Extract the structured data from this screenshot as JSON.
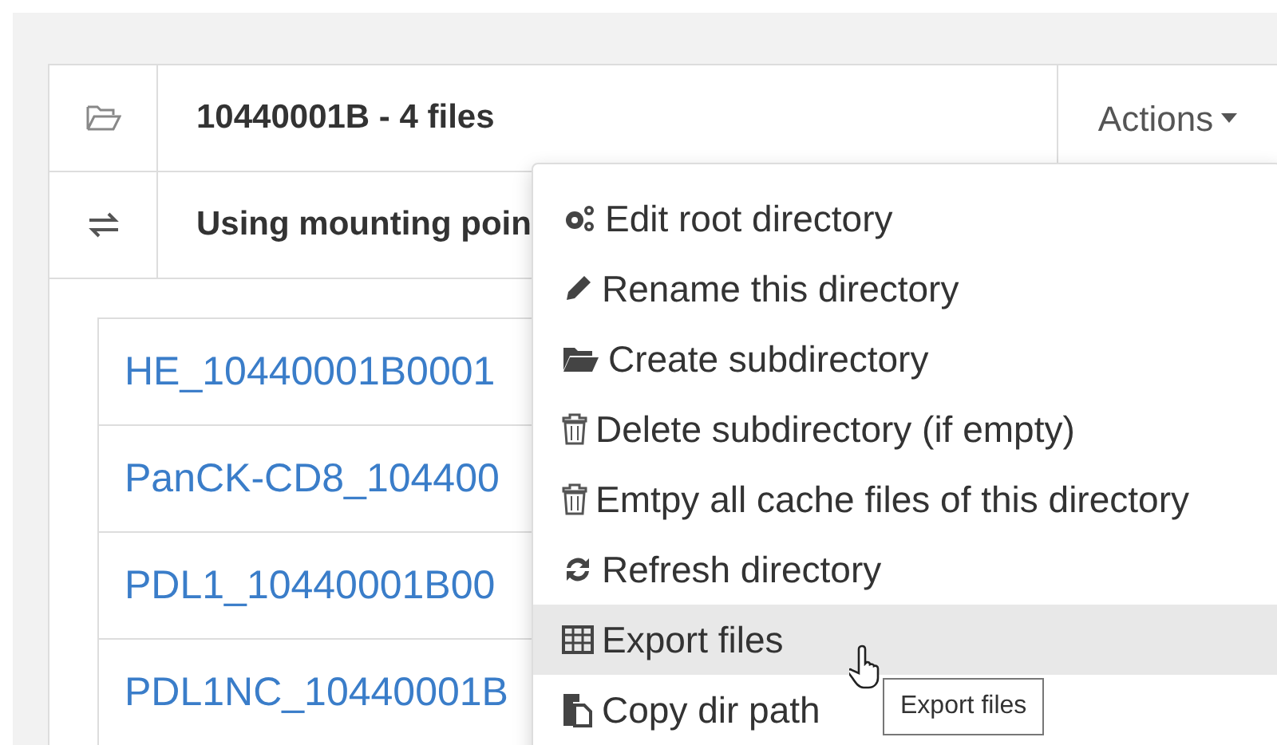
{
  "panel": {
    "title": "10440001B - 4 files",
    "mount_text": "Using mounting poin",
    "actions_label": "Actions",
    "files": [
      "HE_10440001B0001",
      "PanCK-CD8_104400",
      "PDL1_10440001B00",
      "PDL1NC_10440001B"
    ]
  },
  "menu": {
    "items": [
      {
        "label": "Edit root directory",
        "selected": false
      },
      {
        "label": "Rename this directory",
        "selected": false
      },
      {
        "label": "Create subdirectory",
        "selected": false
      },
      {
        "label": "Delete subdirectory (if empty)",
        "selected": false
      },
      {
        "label": "Emtpy all cache files of this directory",
        "selected": false
      },
      {
        "label": "Refresh directory",
        "selected": false
      },
      {
        "label": "Export files",
        "selected": true
      },
      {
        "label": "Copy dir path",
        "selected": false
      }
    ]
  },
  "tooltip": "Export files"
}
